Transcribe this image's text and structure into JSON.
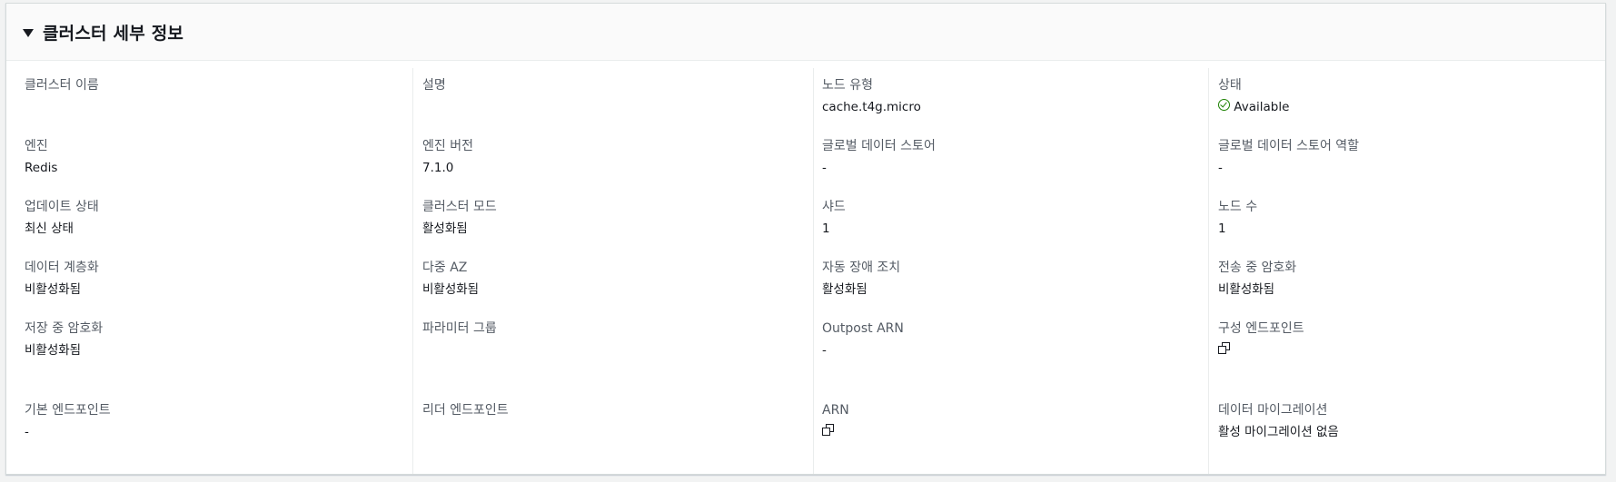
{
  "panel": {
    "title": "클러스터 세부 정보"
  },
  "fields": {
    "cluster_name": {
      "label": "클러스터 이름",
      "value": ""
    },
    "description": {
      "label": "설명",
      "value": ""
    },
    "node_type": {
      "label": "노드 유형",
      "value": "cache.t4g.micro"
    },
    "status": {
      "label": "상태",
      "value": "Available"
    },
    "engine": {
      "label": "엔진",
      "value": "Redis"
    },
    "engine_version": {
      "label": "엔진 버전",
      "value": "7.1.0"
    },
    "global_datastore": {
      "label": "글로벌 데이터 스토어",
      "value": "-"
    },
    "global_datastore_role": {
      "label": "글로벌 데이터 스토어 역할",
      "value": "-"
    },
    "update_status": {
      "label": "업데이트 상태",
      "value": "최신 상태"
    },
    "cluster_mode": {
      "label": "클러스터 모드",
      "value": "활성화됨"
    },
    "shards": {
      "label": "샤드",
      "value": "1"
    },
    "node_count": {
      "label": "노드 수",
      "value": "1"
    },
    "data_tiering": {
      "label": "데이터 계층화",
      "value": "비활성화됨"
    },
    "multi_az": {
      "label": "다중 AZ",
      "value": "비활성화됨"
    },
    "auto_failover": {
      "label": "자동 장애 조치",
      "value": "활성화됨"
    },
    "transit_encryption": {
      "label": "전송 중 암호화",
      "value": "비활성화됨"
    },
    "rest_encryption": {
      "label": "저장 중 암호화",
      "value": "비활성화됨"
    },
    "parameter_group": {
      "label": "파라미터 그룹",
      "value": ""
    },
    "outpost_arn": {
      "label": "Outpost ARN",
      "value": "-"
    },
    "config_endpoint": {
      "label": "구성 엔드포인트",
      "value": ""
    },
    "primary_endpoint": {
      "label": "기본 엔드포인트",
      "value": "-"
    },
    "reader_endpoint": {
      "label": "리더 엔드포인트",
      "value": ""
    },
    "arn": {
      "label": "ARN",
      "value": ""
    },
    "data_migration": {
      "label": "데이터 마이그레이션",
      "value": "활성 마이그레이션 없음"
    }
  },
  "icons": {
    "status": "check-circle-icon",
    "copy": "copy-icon"
  },
  "colors": {
    "status_ok": "#1d8102",
    "label": "#545b64",
    "text": "#16191f",
    "background": "#f2f3f3",
    "panel": "#ffffff",
    "header": "#fafafa"
  }
}
